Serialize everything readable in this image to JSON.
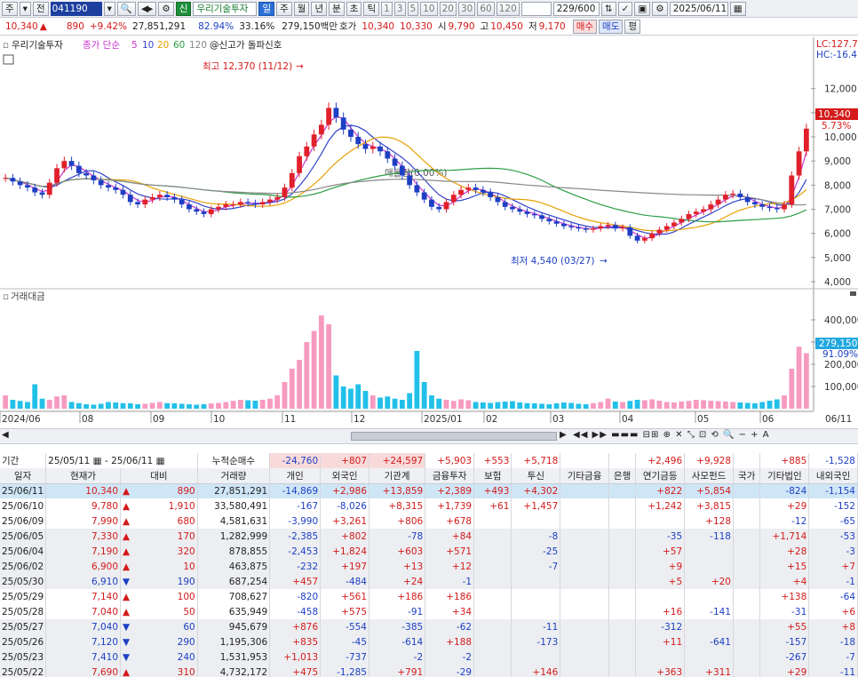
{
  "toolbar": {
    "mode": "주",
    "market": "전",
    "code": "041190",
    "stock_name": "우리기술투자",
    "credit_badge": "신",
    "period_buttons": [
      "일",
      "주",
      "월",
      "년",
      "분",
      "초",
      "틱"
    ],
    "active_period": "일",
    "minute_buttons": [
      "1",
      "3",
      "5",
      "10",
      "20",
      "30",
      "60",
      "120"
    ],
    "range": "229/600",
    "date": "2025/06/11"
  },
  "quote": {
    "price": "10,340",
    "change": "890",
    "change_pct": "+9.42%",
    "volume": "27,851,291",
    "volume_ratio": "82.94%",
    "turnover": "33.16%",
    "amount": "279,150백만",
    "ask_label": "호가",
    "ask1": "10,340",
    "ask2": "10,330",
    "open_label": "시",
    "open": "9,790",
    "high_label": "고",
    "high": "10,450",
    "low_label": "저",
    "low": "9,170",
    "buy": "매수",
    "sell": "매도",
    "eval": "평"
  },
  "chart_legend": {
    "name": "우리기술투자",
    "ma_prefix": "종가 단순",
    "ma_periods": [
      "5",
      "10",
      "20",
      "60",
      "120"
    ],
    "ma_colors": [
      "#cc33cc",
      "#3344cc",
      "#e6a100",
      "#2c9e44",
      "#888888"
    ],
    "signal": "@신고가 돌파신호",
    "lc_label": "LC:127.7",
    "hc_label": "HC:-16.4",
    "high_annot": "최고 12,370 (11/12)",
    "low_annot": "최저 4,540 (03/27)",
    "mid_annot": "매물량(0.00%)",
    "price_tag": "10,340",
    "price_tag_pct": "5.73%",
    "price_axis": [
      "12,000",
      "11,000",
      "10,000",
      "9,000",
      "8,000",
      "7,000",
      "6,000",
      "5,000",
      "4,000"
    ],
    "vol_title": "거래대금",
    "vol_axis": [
      "400,000",
      "300,000",
      "200,000",
      "100,000"
    ],
    "vol_tag": "279,150",
    "vol_tag_pct": "91.09%",
    "date_axis": [
      "2024/06",
      "08",
      "09",
      "10",
      "11",
      "12",
      "2025/01",
      "02",
      "03",
      "04",
      "05",
      "06",
      "06/11"
    ]
  },
  "chart_data": {
    "type": "candlestick",
    "ylim": [
      4000,
      12800
    ],
    "closes": [
      8300,
      8150,
      8000,
      7900,
      7700,
      7600,
      8100,
      8700,
      9000,
      8800,
      8500,
      8400,
      8200,
      8000,
      7900,
      7800,
      7600,
      7300,
      7200,
      7400,
      7500,
      7600,
      7500,
      7400,
      7200,
      7000,
      6900,
      6800,
      7000,
      7100,
      7200,
      7200,
      7300,
      7250,
      7200,
      7300,
      7400,
      7500,
      7900,
      8500,
      9200,
      9600,
      10100,
      10500,
      11200,
      10800,
      10300,
      10000,
      9700,
      9500,
      9600,
      9400,
      9100,
      8800,
      8400,
      8000,
      7700,
      7400,
      7100,
      7000,
      7300,
      7600,
      7800,
      7900,
      7800,
      7700,
      7500,
      7300,
      7100,
      7000,
      6900,
      6800,
      6750,
      6600,
      6500,
      6400,
      6300,
      6250,
      6200,
      6150,
      6200,
      6300,
      6350,
      6200,
      6250,
      5900,
      5700,
      5800,
      6000,
      6150,
      6300,
      6450,
      6600,
      6800,
      6900,
      7000,
      7200,
      7400,
      7600,
      7650,
      7500,
      7300,
      7200,
      7100,
      7050,
      7000,
      7200,
      8400,
      9400,
      10340
    ],
    "volumes": [
      60,
      40,
      35,
      30,
      110,
      45,
      40,
      55,
      60,
      30,
      25,
      20,
      18,
      22,
      30,
      28,
      25,
      24,
      20,
      22,
      26,
      30,
      25,
      24,
      22,
      20,
      18,
      20,
      24,
      26,
      30,
      35,
      40,
      38,
      36,
      40,
      45,
      60,
      120,
      180,
      220,
      300,
      350,
      420,
      380,
      150,
      100,
      90,
      110,
      80,
      60,
      50,
      55,
      45,
      40,
      70,
      260,
      120,
      60,
      45,
      40,
      35,
      42,
      38,
      30,
      28,
      26,
      30,
      32,
      34,
      28,
      25,
      24,
      22,
      20,
      24,
      28,
      26,
      22,
      20,
      25,
      30,
      45,
      32,
      30,
      35,
      40,
      38,
      42,
      36,
      30,
      28,
      32,
      35,
      40,
      38,
      36,
      34,
      32,
      30,
      28,
      26,
      24,
      30,
      36,
      42,
      60,
      180,
      279,
      250
    ],
    "vol_ylim": [
      0,
      480000
    ]
  },
  "table": {
    "period_label": "기간",
    "from": "25/05/11",
    "to": "25/06/11",
    "accum_label": "누적순매수",
    "sum_row": [
      "-24,760",
      "+807",
      "+24,597",
      "+5,903",
      "+553",
      "+5,718",
      "",
      "",
      "+2,496",
      "+9,928",
      "",
      "+885",
      "-1,528"
    ],
    "headers": [
      "일자",
      "현재가",
      "대비",
      "거래량",
      "개인",
      "외국인",
      "기관계",
      "금융투자",
      "보험",
      "투신",
      "기타금융",
      "은행",
      "연기금등",
      "사모펀드",
      "국가",
      "기타법인",
      "내외국인"
    ],
    "rows": [
      {
        "date": "25/06/11",
        "price": "10,340",
        "dir": "up",
        "diff": "890",
        "vol": "27,851,291",
        "c": [
          "-14,869",
          "+2,986",
          "+13,859",
          "+2,389",
          "+493",
          "+4,302",
          "",
          "",
          "+822",
          "+5,854",
          "",
          "-824",
          "-1,154"
        ]
      },
      {
        "date": "25/06/10",
        "price": "9,780",
        "dir": "up",
        "diff": "1,910",
        "vol": "33,580,491",
        "c": [
          "-167",
          "-8,026",
          "+8,315",
          "+1,739",
          "+61",
          "+1,457",
          "",
          "",
          "+1,242",
          "+3,815",
          "",
          "+29",
          "-152"
        ]
      },
      {
        "date": "25/06/09",
        "price": "7,990",
        "dir": "up",
        "diff": "680",
        "vol": "4,581,631",
        "c": [
          "-3,990",
          "+3,261",
          "+806",
          "+678",
          "",
          "",
          "",
          "",
          "",
          "+128",
          "",
          "-12",
          "-65"
        ]
      },
      {
        "date": "25/06/05",
        "price": "7,330",
        "dir": "up",
        "diff": "170",
        "vol": "1,282,999",
        "c": [
          "-2,385",
          "+802",
          "-78",
          "+84",
          "",
          "-8",
          "",
          "",
          "-35",
          "-118",
          "",
          "+1,714",
          "-53"
        ]
      },
      {
        "date": "25/06/04",
        "price": "7,190",
        "dir": "up",
        "diff": "320",
        "vol": "878,855",
        "c": [
          "-2,453",
          "+1,824",
          "+603",
          "+571",
          "",
          "-25",
          "",
          "",
          "+57",
          "",
          "",
          "+28",
          "-3"
        ]
      },
      {
        "date": "25/06/02",
        "price": "6,900",
        "dir": "up",
        "diff": "10",
        "vol": "463,875",
        "c": [
          "-232",
          "+197",
          "+13",
          "+12",
          "",
          "-7",
          "",
          "",
          "+9",
          "",
          "",
          "+15",
          "+7"
        ]
      },
      {
        "date": "25/05/30",
        "price": "6,910",
        "dir": "dn",
        "diff": "190",
        "vol": "687,254",
        "c": [
          "+457",
          "-484",
          "+24",
          "-1",
          "",
          "",
          "",
          "",
          "+5",
          "+20",
          "",
          "+4",
          "-1"
        ]
      },
      {
        "date": "25/05/29",
        "price": "7,140",
        "dir": "up",
        "diff": "100",
        "vol": "708,627",
        "c": [
          "-820",
          "+561",
          "+186",
          "+186",
          "",
          "",
          "",
          "",
          "",
          "",
          "",
          "+138",
          "-64"
        ]
      },
      {
        "date": "25/05/28",
        "price": "7,040",
        "dir": "up",
        "diff": "50",
        "vol": "635,949",
        "c": [
          "-458",
          "+575",
          "-91",
          "+34",
          "",
          "",
          "",
          "",
          "+16",
          "-141",
          "",
          "-31",
          "+6"
        ]
      },
      {
        "date": "25/05/27",
        "price": "7,040",
        "dir": "dn",
        "diff": "60",
        "vol": "945,679",
        "c": [
          "+876",
          "-554",
          "-385",
          "-62",
          "",
          "-11",
          "",
          "",
          "-312",
          "",
          "",
          "+55",
          "+8"
        ]
      },
      {
        "date": "25/05/26",
        "price": "7,120",
        "dir": "dn",
        "diff": "290",
        "vol": "1,195,306",
        "c": [
          "+835",
          "-45",
          "-614",
          "+188",
          "",
          "-173",
          "",
          "",
          "+11",
          "-641",
          "",
          "-157",
          "-18"
        ]
      },
      {
        "date": "25/05/23",
        "price": "7,410",
        "dir": "dn",
        "diff": "240",
        "vol": "1,531,953",
        "c": [
          "+1,013",
          "-737",
          "-2",
          "-2",
          "",
          "",
          "",
          "",
          "",
          "",
          "",
          "-267",
          "-7"
        ]
      },
      {
        "date": "25/05/22",
        "price": "7,690",
        "dir": "up",
        "diff": "310",
        "vol": "4,732,172",
        "c": [
          "+475",
          "-1,285",
          "+791",
          "-29",
          "",
          "+146",
          "",
          "",
          "+363",
          "+311",
          "",
          "+29",
          "-11"
        ]
      }
    ]
  }
}
